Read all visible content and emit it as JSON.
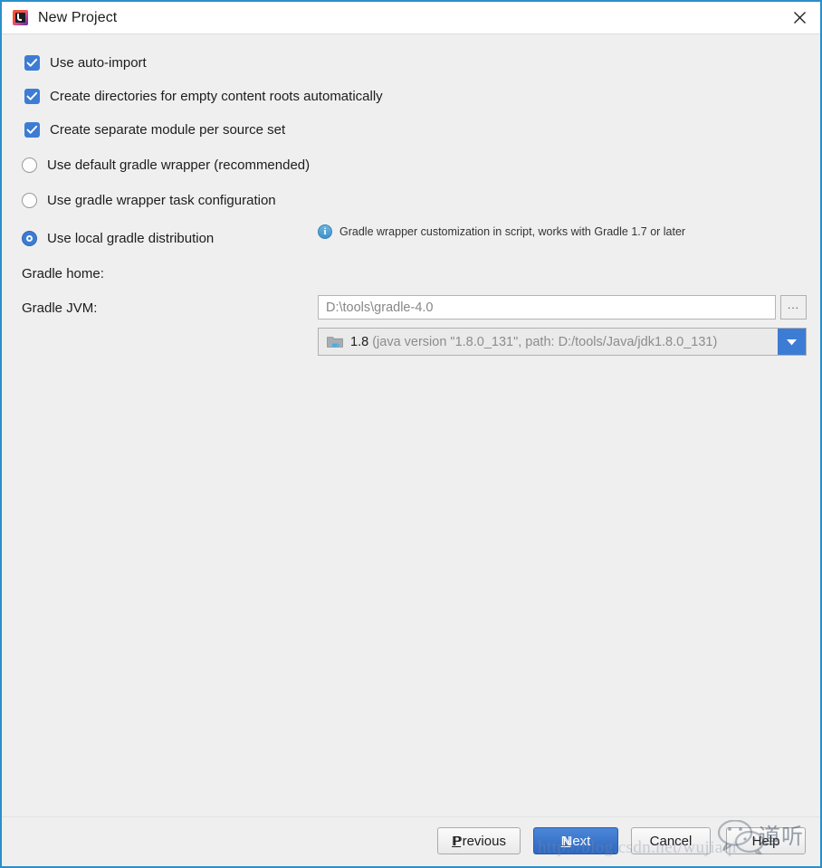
{
  "window": {
    "title": "New Project",
    "app_icon": "intellij-idea-icon",
    "close_icon": "close-icon",
    "border_color": "#2b8fc9"
  },
  "options": {
    "checkboxes": [
      {
        "label": "Use auto-import",
        "checked": true
      },
      {
        "label": "Create directories for empty content roots automatically",
        "checked": true
      },
      {
        "label": "Create separate module per source set",
        "checked": true
      }
    ],
    "radios": [
      {
        "label": "Use default gradle wrapper (recommended)",
        "selected": false
      },
      {
        "label": "Use gradle wrapper task configuration",
        "selected": false
      },
      {
        "label": "Use local gradle distribution",
        "selected": true
      }
    ],
    "hint": {
      "icon": "info-icon",
      "text": "Gradle wrapper customization in script, works with Gradle 1.7 or later"
    }
  },
  "fields": {
    "gradle_home": {
      "label": "Gradle home:",
      "value": "D:\\tools\\gradle-4.0",
      "placeholder": "D:\\tools\\gradle-4.0",
      "browse_label": "...",
      "browse_icon": "ellipsis-icon"
    },
    "gradle_jvm": {
      "label": "Gradle JVM:",
      "icon": "jdk-folder-icon",
      "version": "1.8",
      "detail": "(java version \"1.8.0_131\", path: D:/tools/Java/jdk1.8.0_131)",
      "arrow_icon": "chevron-down-icon"
    }
  },
  "buttons": {
    "previous": {
      "label": "Previous",
      "mnemonic": "P",
      "primary": false
    },
    "next": {
      "label": "Next",
      "mnemonic": "N",
      "primary": true
    },
    "cancel": {
      "label": "Cancel",
      "mnemonic": "",
      "primary": false
    },
    "help": {
      "label": "Help",
      "mnemonic": "",
      "primary": false
    }
  },
  "watermark": {
    "url": "http://blog.csdn.net/wujiaqi",
    "wechat_text": "道听",
    "wechat_icon": "wechat-logo-icon"
  },
  "colors": {
    "accent": "#3d7cd4",
    "primary_button": "#3168c0",
    "window_border": "#2b8fc9",
    "content_bg": "#efefef"
  }
}
